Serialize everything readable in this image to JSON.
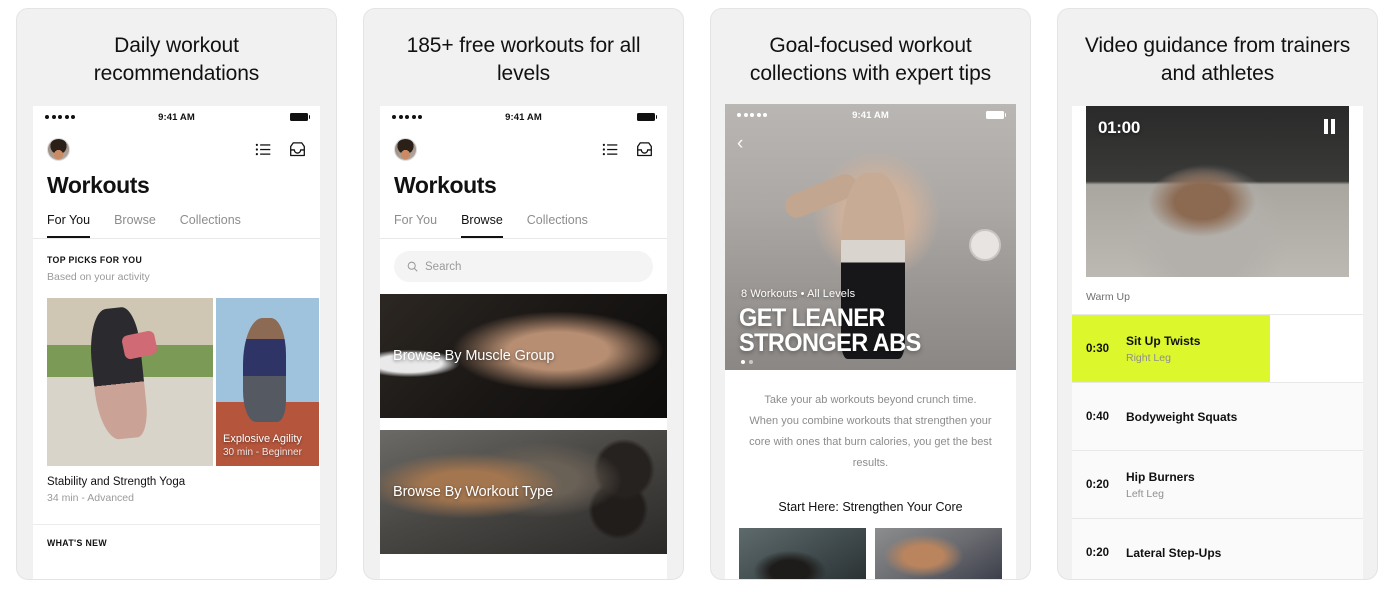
{
  "cards": [
    {
      "title": "Daily workout recommendations",
      "phone": {
        "clock": "9:41 AM",
        "app_title": "Workouts",
        "tabs": [
          {
            "label": "For You",
            "active": true
          },
          {
            "label": "Browse",
            "active": false
          },
          {
            "label": "Collections",
            "active": false
          }
        ],
        "section_eyebrow": "TOP PICKS FOR YOU",
        "section_sub": "Based on your activity",
        "primary_card": {
          "title": "Stability and Strength Yoga",
          "meta": "34 min - Advanced"
        },
        "secondary_card": {
          "title": "Explosive Agility",
          "meta": "30 min - Beginner"
        },
        "next_eyebrow": "WHAT'S NEW",
        "icons": {
          "list": "list-icon",
          "inbox": "inbox-icon",
          "avatar": "avatar"
        }
      }
    },
    {
      "title": "185+ free workouts for all levels",
      "phone": {
        "clock": "9:41 AM",
        "app_title": "Workouts",
        "tabs": [
          {
            "label": "For You",
            "active": false
          },
          {
            "label": "Browse",
            "active": true
          },
          {
            "label": "Collections",
            "active": false
          }
        ],
        "search_placeholder": "Search",
        "tiles": [
          {
            "label": "Browse By Muscle Group"
          },
          {
            "label": "Browse By Workout Type"
          }
        ]
      }
    },
    {
      "title": "Goal-focused workout collections with expert tips",
      "phone": {
        "clock": "9:41 AM",
        "hero_kicker": "8 Workouts • All Levels",
        "hero_title_line1": "GET LEANER",
        "hero_title_line2": "STRONGER ABS",
        "paragraph": "Take your ab workouts beyond crunch time. When you combine workouts that strengthen your core with ones that burn calories, you get the best results.",
        "start_here": "Start Here: Strengthen Your Core",
        "back_icon": "chevron-left-icon"
      }
    },
    {
      "title": "Video guidance from trainers and athletes",
      "phone": {
        "timer": "01:00",
        "pause_icon": "pause-icon",
        "section_label": "Warm Up",
        "exercises": [
          {
            "time": "0:30",
            "name": "Sit Up Twists",
            "detail": "Right Leg",
            "highlight": true,
            "progress": 68
          },
          {
            "time": "0:40",
            "name": "Bodyweight Squats",
            "detail": "",
            "highlight": false,
            "progress": 0
          },
          {
            "time": "0:20",
            "name": "Hip Burners",
            "detail": "Left Leg",
            "highlight": false,
            "progress": 0
          },
          {
            "time": "0:20",
            "name": "Lateral Step-Ups",
            "detail": "",
            "highlight": false,
            "progress": 0
          }
        ]
      }
    }
  ],
  "colors": {
    "highlight": "#dcf72b",
    "text": "#111111",
    "muted": "#8f8f8f",
    "card_bg": "#f1f1f1"
  }
}
